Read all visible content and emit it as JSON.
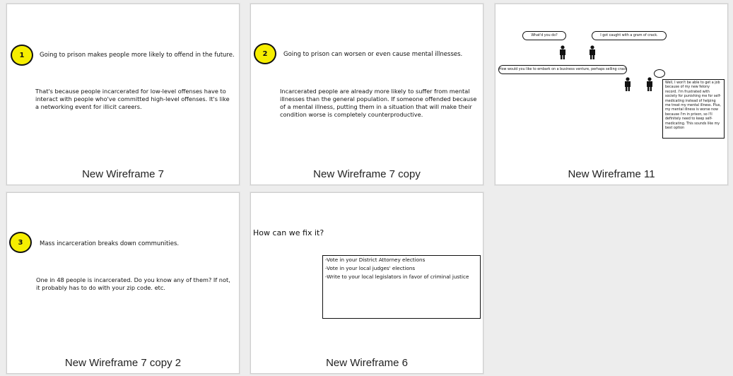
{
  "cards": [
    {
      "caption": "New Wireframe 7",
      "badge": "1",
      "headline": "Going to prison makes people more likely to offend in the future.",
      "body": "That's because people incarcerated for low-level offenses have to interact with people who've committed high-level offenses. It's like a networking event for illicit careers."
    },
    {
      "caption": "New Wireframe 7 copy",
      "badge": "2",
      "headline": "Going to prison can worsen or even cause mental illnesses.",
      "body": "Incarcerated people are already more likely to suffer from mental illnesses than the general population. If someone offended because of a mental illness, putting them in a situation that will make their condition worse is completely counterproductive."
    },
    {
      "caption": "New Wireframe 11",
      "bubbles": {
        "q1": "What'd you do?",
        "a1": "I got caught with a gram of crack.",
        "q2": "How would you like to embark on a business venture, perhaps selling crack?"
      },
      "note": "Well, I won't be able to get a job because of my new felony record. I'm frustrated with society for punishing me for self-medicating instead of helping me treat my mental illness. Plus, my mental illness is worse now because I'm in prison, so I'll definitely need to keep self-medicating. This sounds like my best option"
    },
    {
      "caption": "New Wireframe 7 copy 2",
      "badge": "3",
      "headline": "Mass incarceration breaks down communities.",
      "body": "One in 48 people is incarcerated. Do you know any of them? If not, it probably has to do with your zip code. etc."
    },
    {
      "caption": "New Wireframe 6",
      "heading": "How can we fix it?",
      "items": [
        "-Vote in your District Attorney elections",
        "-Vote in your local judges' elections",
        "-Write to your local legislators in favor of criminal justice"
      ]
    }
  ],
  "colors": {
    "badge_fill": "#f6ee00",
    "background": "#ededed"
  }
}
